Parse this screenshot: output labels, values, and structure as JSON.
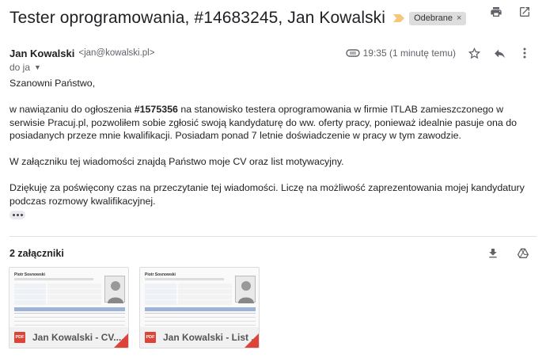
{
  "header": {
    "subject": "Tester oprogramowania, #14683245, Jan Kowalski",
    "label": "Odebrane",
    "label_remove": "×"
  },
  "sender": {
    "name": "Jan Kowalski",
    "email": "<jan@kowalski.pl>",
    "timestamp": "19:35 (1 minutę temu)",
    "to": "do ja"
  },
  "body": {
    "greeting": "Szanowni Państwo,",
    "p1_before": "w nawiązaniu do ogłoszenia ",
    "p1_bold": "#1575356",
    "p1_after": " na stanowisko testera oprogramowania w firmie ITLAB zamieszczonego w serwisie Pracuj.pl, pozwoliłem sobie zgłosić swoją kandydaturę do ww. oferty pracy, ponieważ idealnie pasuje ona do posiadanych przeze mnie kwalifikacji. Posiadam ponad 7 letnie doświadczenie w pracy w tym zawodzie.",
    "p2": "W załączniku tej wiadomości znajdą Państwo moje CV oraz list motywacyjny.",
    "p3": "Dziękuję za poświęcony czas na przeczytanie tej wiadomości. Liczę na możliwość zaprezentowania mojej kandydatury podczas rozmowy kwalifikacyjnej."
  },
  "attachments": {
    "title": "2 załączniki",
    "items": [
      {
        "name": "Jan Kowalski - CV....",
        "type": "PDF",
        "doc_title": "Piotr Sosnowski"
      },
      {
        "name": "Jan Kowalski - List ...",
        "type": "PDF",
        "doc_title": "Piotr Sosnowski"
      }
    ]
  },
  "icons": {
    "importance": "importance-marker-icon",
    "print": "print-icon",
    "open_new_window": "open-in-new-window-icon",
    "unsubscribe": "badge-icon",
    "star": "star-icon",
    "reply": "reply-icon",
    "more": "more-vert-icon",
    "dropdown": "caret-down-icon",
    "download": "download-icon",
    "drive": "save-to-drive-icon"
  },
  "colors": {
    "importance": "#f6c67a",
    "pdf": "#db4437",
    "chip_bg": "#dddddd"
  }
}
